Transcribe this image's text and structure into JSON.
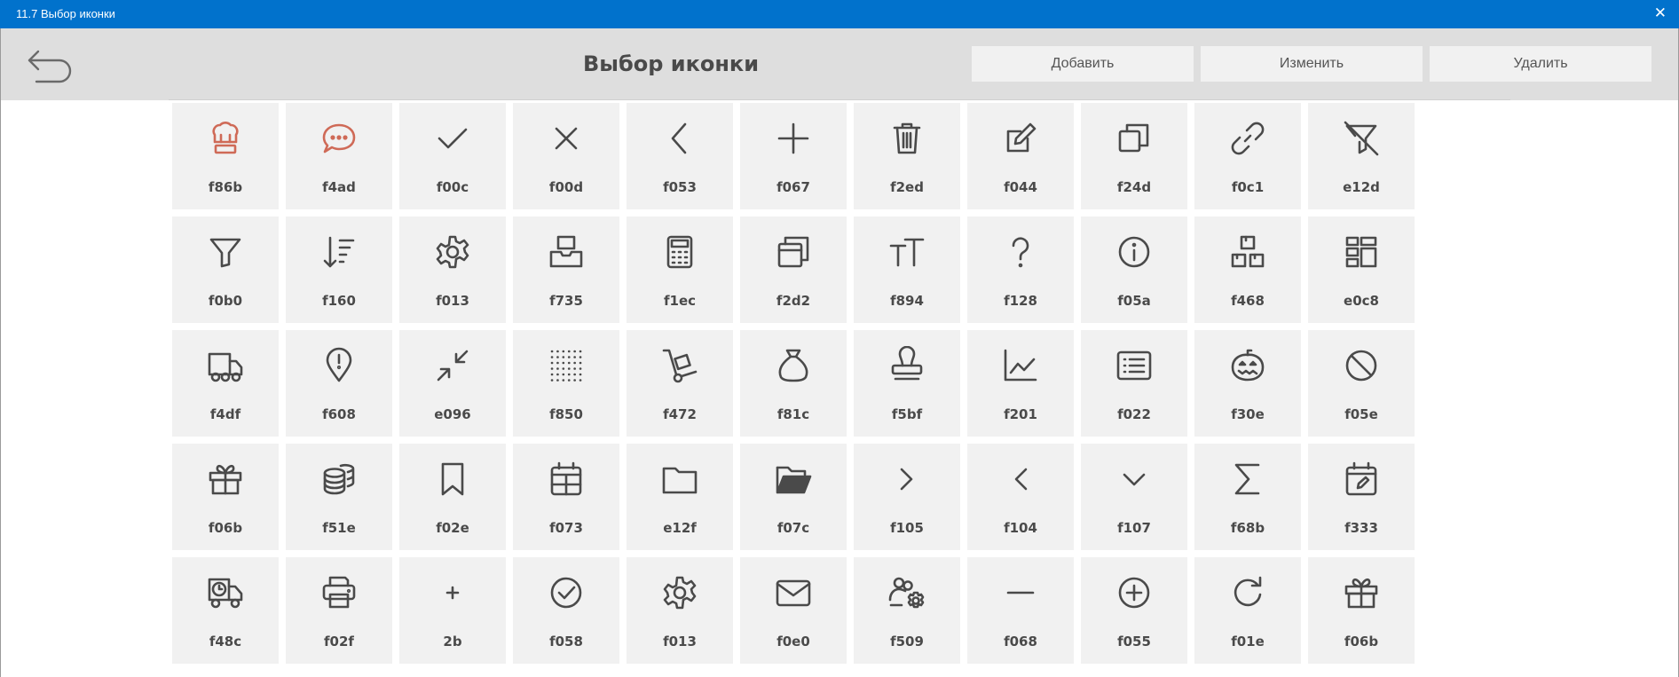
{
  "window": {
    "title": "11.7 Выбор иконки",
    "close_label": "✕"
  },
  "header": {
    "title": "Выбор иконки",
    "add_label": "Добавить",
    "edit_label": "Изменить",
    "delete_label": "Удалить"
  },
  "colors": {
    "titlebar": "#0172CC",
    "header": "#DEDEDE",
    "tile": "#F1F1F1",
    "icon": "#4A4A4A",
    "accent_icon": "#CF6A57"
  },
  "icons": [
    {
      "code": "f86b",
      "icon": "chef-hat-icon"
    },
    {
      "code": "f4ad",
      "icon": "comment-dots-icon"
    },
    {
      "code": "f00c",
      "icon": "check-icon"
    },
    {
      "code": "f00d",
      "icon": "xmark-icon"
    },
    {
      "code": "f053",
      "icon": "chevron-left-icon"
    },
    {
      "code": "f067",
      "icon": "plus-icon"
    },
    {
      "code": "f2ed",
      "icon": "trash-icon"
    },
    {
      "code": "f044",
      "icon": "pen-to-square-icon"
    },
    {
      "code": "f24d",
      "icon": "clone-icon"
    },
    {
      "code": "f0c1",
      "icon": "link-icon"
    },
    {
      "code": "e12d",
      "icon": "filter-slash-icon"
    },
    {
      "code": "f0b0",
      "icon": "filter-icon"
    },
    {
      "code": "f160",
      "icon": "sort-amount-icon"
    },
    {
      "code": "f013",
      "icon": "gear-icon"
    },
    {
      "code": "f735",
      "icon": "inbox-tray-icon"
    },
    {
      "code": "f1ec",
      "icon": "calculator-icon"
    },
    {
      "code": "f2d2",
      "icon": "window-restore-icon"
    },
    {
      "code": "f894",
      "icon": "text-size-icon"
    },
    {
      "code": "f128",
      "icon": "question-icon"
    },
    {
      "code": "f05a",
      "icon": "info-circle-icon"
    },
    {
      "code": "f468",
      "icon": "boxes-icon"
    },
    {
      "code": "e0c8",
      "icon": "dashboard-grid-icon"
    },
    {
      "code": "f4df",
      "icon": "truck-icon"
    },
    {
      "code": "f608",
      "icon": "location-exclamation-icon"
    },
    {
      "code": "e096",
      "icon": "compress-arrows-icon"
    },
    {
      "code": "f850",
      "icon": "dot-grid-icon"
    },
    {
      "code": "f472",
      "icon": "dolly-icon"
    },
    {
      "code": "f81c",
      "icon": "sack-icon"
    },
    {
      "code": "f5bf",
      "icon": "stamp-icon"
    },
    {
      "code": "f201",
      "icon": "chart-line-icon"
    },
    {
      "code": "f022",
      "icon": "list-alt-icon"
    },
    {
      "code": "f30e",
      "icon": "jack-o-lantern-icon"
    },
    {
      "code": "f05e",
      "icon": "ban-icon"
    },
    {
      "code": "f06b",
      "icon": "gift-icon"
    },
    {
      "code": "f51e",
      "icon": "coins-icon"
    },
    {
      "code": "f02e",
      "icon": "bookmark-icon"
    },
    {
      "code": "f073",
      "icon": "calendar-icon"
    },
    {
      "code": "e12f",
      "icon": "folder-icon"
    },
    {
      "code": "f07c",
      "icon": "folder-open-icon"
    },
    {
      "code": "f105",
      "icon": "angle-right-icon"
    },
    {
      "code": "f104",
      "icon": "angle-left-icon"
    },
    {
      "code": "f107",
      "icon": "angle-down-icon"
    },
    {
      "code": "f68b",
      "icon": "sigma-icon"
    },
    {
      "code": "f333",
      "icon": "calendar-edit-icon"
    },
    {
      "code": "f48c",
      "icon": "shipping-timed-icon"
    },
    {
      "code": "f02f",
      "icon": "print-icon"
    },
    {
      "code": "2b",
      "icon": "plus-small-icon"
    },
    {
      "code": "f058",
      "icon": "circle-check-icon"
    },
    {
      "code": "f013",
      "icon": "gear-icon"
    },
    {
      "code": "f0e0",
      "icon": "envelope-icon"
    },
    {
      "code": "f509",
      "icon": "users-gear-icon"
    },
    {
      "code": "f068",
      "icon": "minus-icon"
    },
    {
      "code": "f055",
      "icon": "circle-plus-icon"
    },
    {
      "code": "f01e",
      "icon": "rotate-right-icon"
    },
    {
      "code": "f06b",
      "icon": "gift-icon"
    }
  ]
}
